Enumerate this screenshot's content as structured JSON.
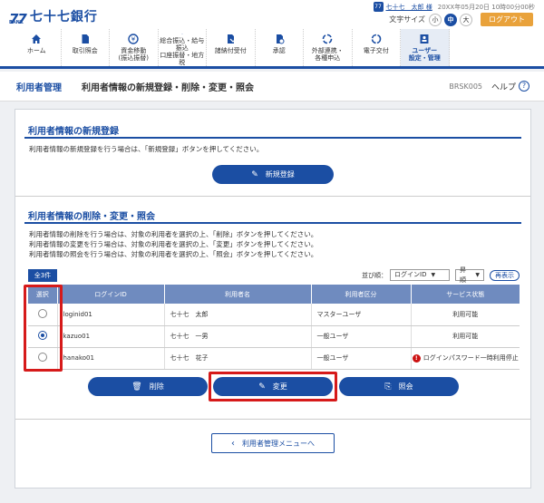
{
  "header": {
    "logo_mark": "77",
    "logo_bank": "BANK",
    "bank_name": "七十七銀行",
    "user_icon": "77",
    "user_name": "七十七　太郎 様",
    "login_time": "20XX年05月20日 10時00分00秒",
    "font_size_label": "文字サイズ",
    "font_sizes": [
      "小",
      "中",
      "大"
    ],
    "font_size_selected": "中",
    "logout": "ログアウト"
  },
  "nav": [
    {
      "label": "ホーム",
      "icon": "home-icon"
    },
    {
      "label": "取引照会",
      "icon": "document-icon"
    },
    {
      "label": "資金移動\n(振込振替)",
      "icon": "money-transfer-icon"
    },
    {
      "label": "総合振込・給与振込\n口座振替・地方税",
      "icon": "card-icon"
    },
    {
      "label": "諸納付受付",
      "icon": "payment-icon"
    },
    {
      "label": "承認",
      "icon": "approval-icon"
    },
    {
      "label": "外部連携・\n各種申込",
      "icon": "link-icon"
    },
    {
      "label": "電子交付",
      "icon": "electronic-delivery-icon"
    },
    {
      "label": "ユーザー\n設定・管理",
      "icon": "user-management-icon"
    }
  ],
  "titlebar": {
    "section": "利用者管理",
    "title": "利用者情報の新規登録・削除・変更・照会",
    "screen_code": "BRSK005",
    "help": "ヘルプ"
  },
  "register": {
    "heading": "利用者情報の新規登録",
    "desc": "利用者情報の新規登録を行う場合は、「新規登録」ボタンを押してください。",
    "button": "新規登録"
  },
  "manage": {
    "heading": "利用者情報の削除・変更・照会",
    "desc": [
      "利用者情報の削除を行う場合は、対象の利用者を選択の上、「削除」ボタンを押してください。",
      "利用者情報の変更を行う場合は、対象の利用者を選択の上、「変更」ボタンを押してください。",
      "利用者情報の照会を行う場合は、対象の利用者を選択の上、「照会」ボタンを押してください。"
    ],
    "count": "全3件",
    "sort_label": "並び順：",
    "sort_key": "ログインID",
    "sort_order": "昇順",
    "redisplay": "再表示",
    "columns": [
      "選択",
      "ログインID",
      "利用者名",
      "利用者区分",
      "サービス状態"
    ],
    "rows": [
      {
        "login_id": "loginid01",
        "name": "七十七　太郎",
        "category": "マスターユーザ",
        "status": "利用可能",
        "selected": false,
        "warn": false
      },
      {
        "login_id": "kazuo01",
        "name": "七十七　一男",
        "category": "一般ユーザ",
        "status": "利用可能",
        "selected": true,
        "warn": false
      },
      {
        "login_id": "hanako01",
        "name": "七十七　花子",
        "category": "一般ユーザ",
        "status": "ログインパスワード一時利用停止",
        "selected": false,
        "warn": true
      }
    ],
    "buttons": {
      "delete": "削除",
      "change": "変更",
      "inquiry": "照会"
    },
    "back": "利用者管理メニューへ"
  },
  "colors": {
    "primary": "#1b4ea3",
    "accent": "#e9a23b",
    "highlight": "#d61a1a",
    "table_header": "#6f8bbf"
  }
}
